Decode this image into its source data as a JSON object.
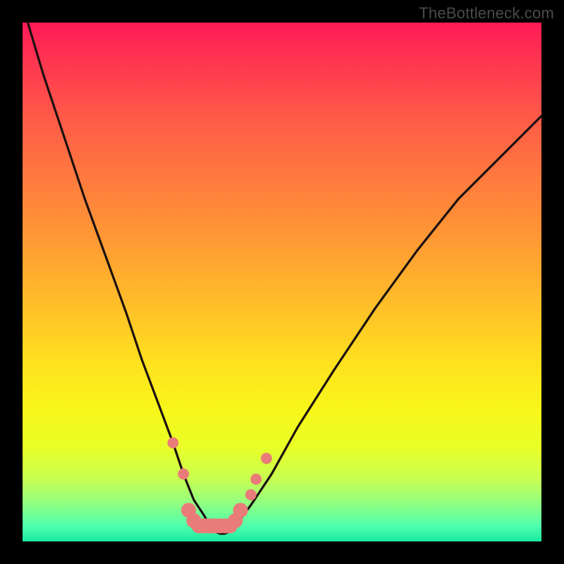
{
  "attribution": "TheBottleneck.com",
  "colors": {
    "frame": "#000000",
    "curve_stroke": "#1b1010",
    "marker_fill": "#e97c78",
    "gradient_top": "#ff1a56",
    "gradient_bottom": "#18e9a0"
  },
  "chart_data": {
    "type": "line",
    "title": "",
    "xlabel": "",
    "ylabel": "",
    "xlim": [
      0,
      100
    ],
    "ylim": [
      0,
      100
    ],
    "grid": false,
    "legend": false,
    "series": [
      {
        "name": "bottleneck-curve",
        "x": [
          1,
          4,
          8,
          12,
          16,
          20,
          23,
          26,
          29,
          31,
          33,
          35,
          36,
          37,
          38,
          39,
          40,
          41,
          44,
          48,
          53,
          60,
          68,
          76,
          84,
          92,
          100
        ],
        "values": [
          100,
          90,
          78,
          66,
          55,
          44,
          35,
          27,
          19,
          13,
          8,
          5,
          3,
          2,
          1.5,
          1.5,
          2,
          3,
          7,
          13,
          22,
          33,
          45,
          56,
          66,
          74,
          82
        ]
      }
    ],
    "markers": [
      {
        "x": 29,
        "y": 19,
        "r": 1.2
      },
      {
        "x": 31,
        "y": 13,
        "r": 1.2
      },
      {
        "x": 32,
        "y": 6,
        "r": 1.6
      },
      {
        "x": 33,
        "y": 4,
        "r": 1.6
      },
      {
        "x": 34,
        "y": 3,
        "r": 1.6
      },
      {
        "x": 35,
        "y": 3,
        "r": 1.6
      },
      {
        "x": 36,
        "y": 3,
        "r": 1.6
      },
      {
        "x": 37,
        "y": 3,
        "r": 1.6
      },
      {
        "x": 38,
        "y": 3,
        "r": 1.6
      },
      {
        "x": 39,
        "y": 3,
        "r": 1.6
      },
      {
        "x": 40,
        "y": 3,
        "r": 1.6
      },
      {
        "x": 41,
        "y": 4,
        "r": 1.6
      },
      {
        "x": 42,
        "y": 6,
        "r": 1.6
      },
      {
        "x": 44,
        "y": 9,
        "r": 1.2
      },
      {
        "x": 45,
        "y": 12,
        "r": 1.2
      },
      {
        "x": 47,
        "y": 16,
        "r": 1.2
      }
    ]
  }
}
